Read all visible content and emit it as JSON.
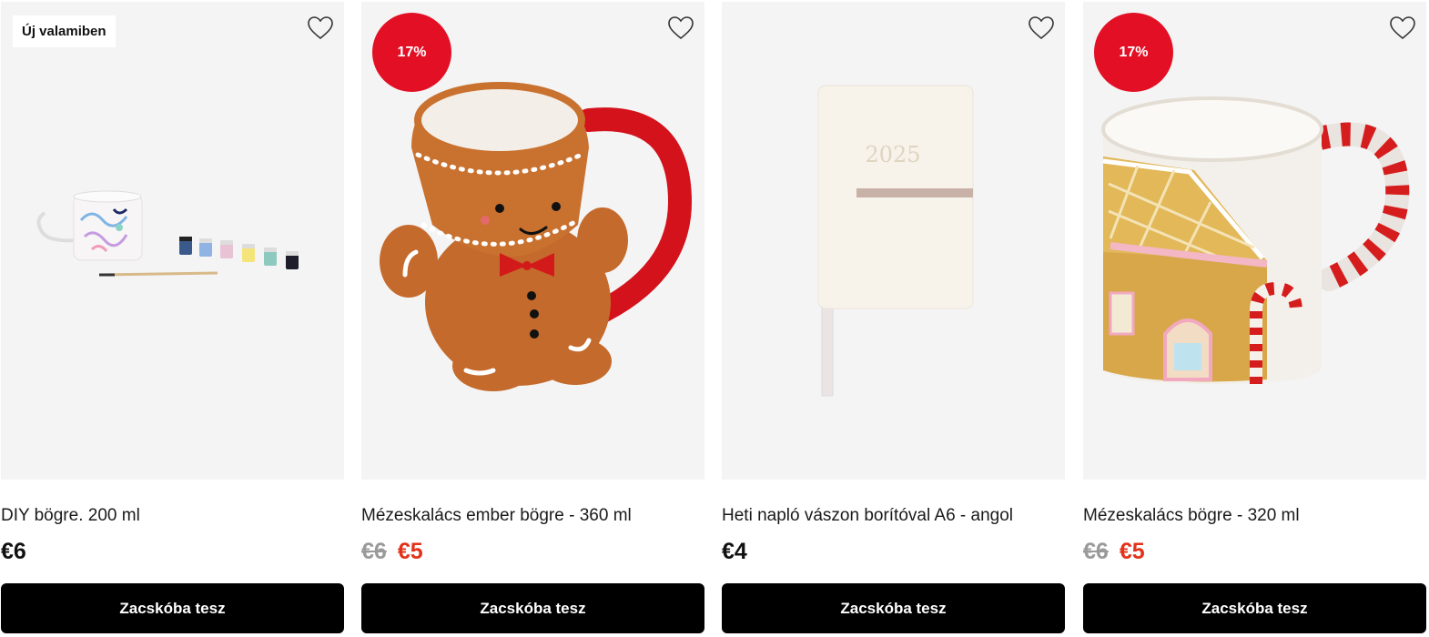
{
  "colors": {
    "accent_red": "#e30f25",
    "sale_price": "#e3321a",
    "button_bg": "#000000",
    "card_bg": "#f4f4f4"
  },
  "products": [
    {
      "badge_new": "Új valamiben",
      "title": "DIY bögre. 200 ml",
      "price": "€6",
      "button": "Zacskóba tesz",
      "icon": "heart-outline-icon"
    },
    {
      "badge_discount": "17%",
      "title": "Mézeskalács ember bögre - 360 ml",
      "old_price": "€6",
      "sale_price": "€5",
      "button": "Zacskóba tesz",
      "icon": "heart-outline-icon"
    },
    {
      "image_text": "2025",
      "title": "Heti napló vászon borítóval A6 - angol",
      "price": "€4",
      "button": "Zacskóba tesz",
      "icon": "heart-outline-icon"
    },
    {
      "badge_discount": "17%",
      "title": "Mézeskalács bögre - 320 ml",
      "old_price": "€6",
      "sale_price": "€5",
      "button": "Zacskóba tesz",
      "icon": "heart-outline-icon"
    }
  ]
}
